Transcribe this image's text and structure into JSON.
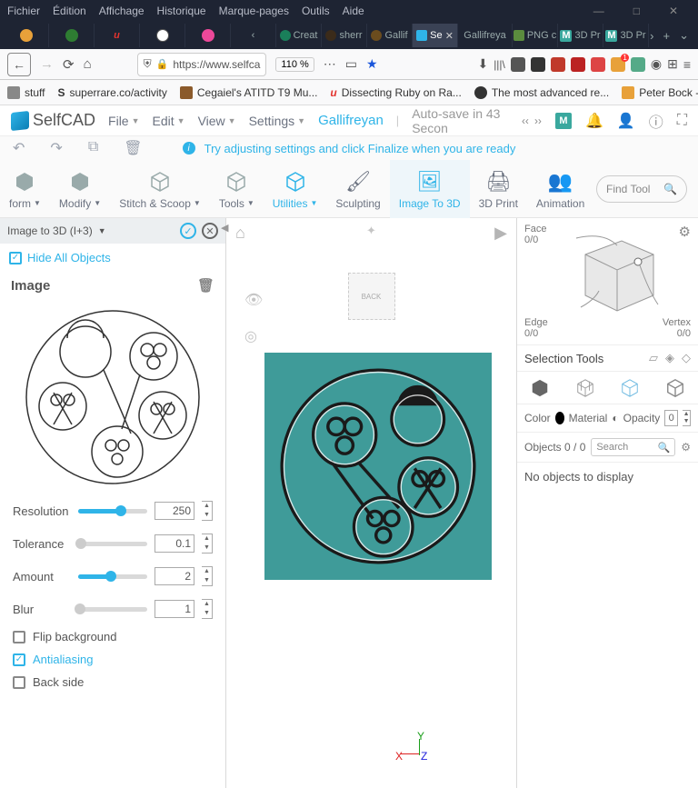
{
  "titlebar": {
    "menus": [
      "Fichier",
      "Édition",
      "Affichage",
      "Historique",
      "Marque-pages",
      "Outils",
      "Aide"
    ]
  },
  "browser_tabs": [
    {
      "label": "",
      "color": "#e8a13a"
    },
    {
      "label": "",
      "color": "#2e7d32"
    },
    {
      "label": "u",
      "color": "#e3342f"
    },
    {
      "label": "",
      "color": "#fff"
    },
    {
      "label": "",
      "color": "#ec4899"
    },
    {
      "label": "‹",
      "color": ""
    },
    {
      "label": "Creat",
      "color": "#1a7f5a"
    },
    {
      "label": "sherr",
      "color": "#3b2b1a"
    },
    {
      "label": "Gallif",
      "color": "#6b4c1e"
    },
    {
      "label": "Se",
      "color": "#2fb4e8",
      "active": true,
      "closable": true
    },
    {
      "label": "Gallifreya",
      "color": ""
    },
    {
      "label": "PNG c",
      "color": "#5b8c3e"
    },
    {
      "label": "3D Pr",
      "color": "#3aa89e",
      "prefix": "M"
    },
    {
      "label": "3D Pr",
      "color": "#3aa89e",
      "prefix": "M"
    }
  ],
  "url": {
    "text": "https://www.selfca",
    "zoom": "110 %"
  },
  "bookmarks": [
    {
      "label": "stuff",
      "icon": "#888"
    },
    {
      "label": "superrare.co/activity",
      "icon": "#000",
      "prefix": "S"
    },
    {
      "label": "Cegaiel's ATITD T9 Mu...",
      "icon": "#8b5a2b"
    },
    {
      "label": "Dissecting Ruby on Ra...",
      "icon": "#e3342f",
      "prefix": "u"
    },
    {
      "label": "The most advanced re...",
      "icon": "#333"
    },
    {
      "label": "Peter Bock - Cryptoart...",
      "icon": "#e8a13a"
    }
  ],
  "app": {
    "logo": "SelfCAD",
    "menus": [
      "File",
      "Edit",
      "View",
      "Settings"
    ],
    "project": "Gallifreyan",
    "autosave": "Auto-save in 43 Secon"
  },
  "info": "Try adjusting settings and click Finalize when you are ready",
  "tools": [
    {
      "label": "form",
      "caret": true
    },
    {
      "label": "Modify",
      "caret": true
    },
    {
      "label": "Stitch & Scoop",
      "caret": true
    },
    {
      "label": "Tools",
      "caret": true
    },
    {
      "label": "Utilities",
      "caret": true,
      "accent": true
    },
    {
      "label": "Sculpting"
    },
    {
      "label": "Image To 3D",
      "active": true
    },
    {
      "label": "3D Print"
    },
    {
      "label": "Animation"
    }
  ],
  "findtool_ph": "Find Tool",
  "left": {
    "header": "Image to 3D (I+3)",
    "hide": "Hide All Objects",
    "section": "Image",
    "params": [
      {
        "label": "Resolution",
        "value": "250",
        "fill": 62
      },
      {
        "label": "Tolerance",
        "value": "0.1",
        "fill": 4
      },
      {
        "label": "Amount",
        "value": "2",
        "fill": 48
      },
      {
        "label": "Blur",
        "value": "1",
        "fill": 2
      }
    ],
    "checks": [
      {
        "label": "Flip background",
        "on": false
      },
      {
        "label": "Antialiasing",
        "on": true,
        "accent": true
      },
      {
        "label": "Back side",
        "on": false
      }
    ]
  },
  "viewport": {
    "back": "BACK",
    "axes": {
      "x": "X",
      "y": "Y",
      "z": "Z"
    }
  },
  "right": {
    "face": "Face",
    "face_v": "0/0",
    "edge": "Edge",
    "edge_v": "0/0",
    "vertex": "Vertex",
    "vertex_v": "0/0",
    "seltools": "Selection Tools",
    "color": "Color",
    "material": "Material",
    "opacity": "Opacity",
    "opval": "0",
    "objects": "Objects 0 / 0",
    "search_ph": "Search",
    "noobj": "No objects to display"
  }
}
